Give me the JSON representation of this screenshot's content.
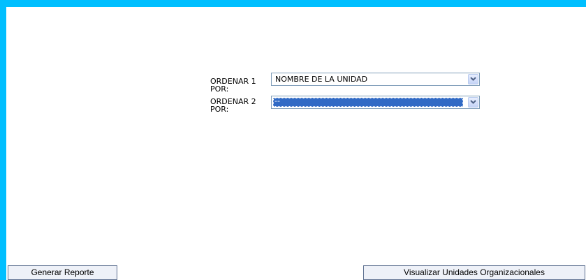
{
  "sort_form": {
    "field1": {
      "label": "ORDENAR 1 POR:",
      "value": "NOMBRE DE LA UNIDAD"
    },
    "field2": {
      "label": "ORDENAR 2 POR:",
      "value": "--"
    }
  },
  "buttons": {
    "generate_report": "Generar Reporte",
    "view_units": "Visualizar Unidades Organizacionales"
  },
  "icons": {
    "dropdown": "chevron-down-icon"
  },
  "colors": {
    "frame": "#00BFFF",
    "background": "#FFFFFF",
    "selection": "#316AC5",
    "field_border": "#7F9DB9"
  }
}
